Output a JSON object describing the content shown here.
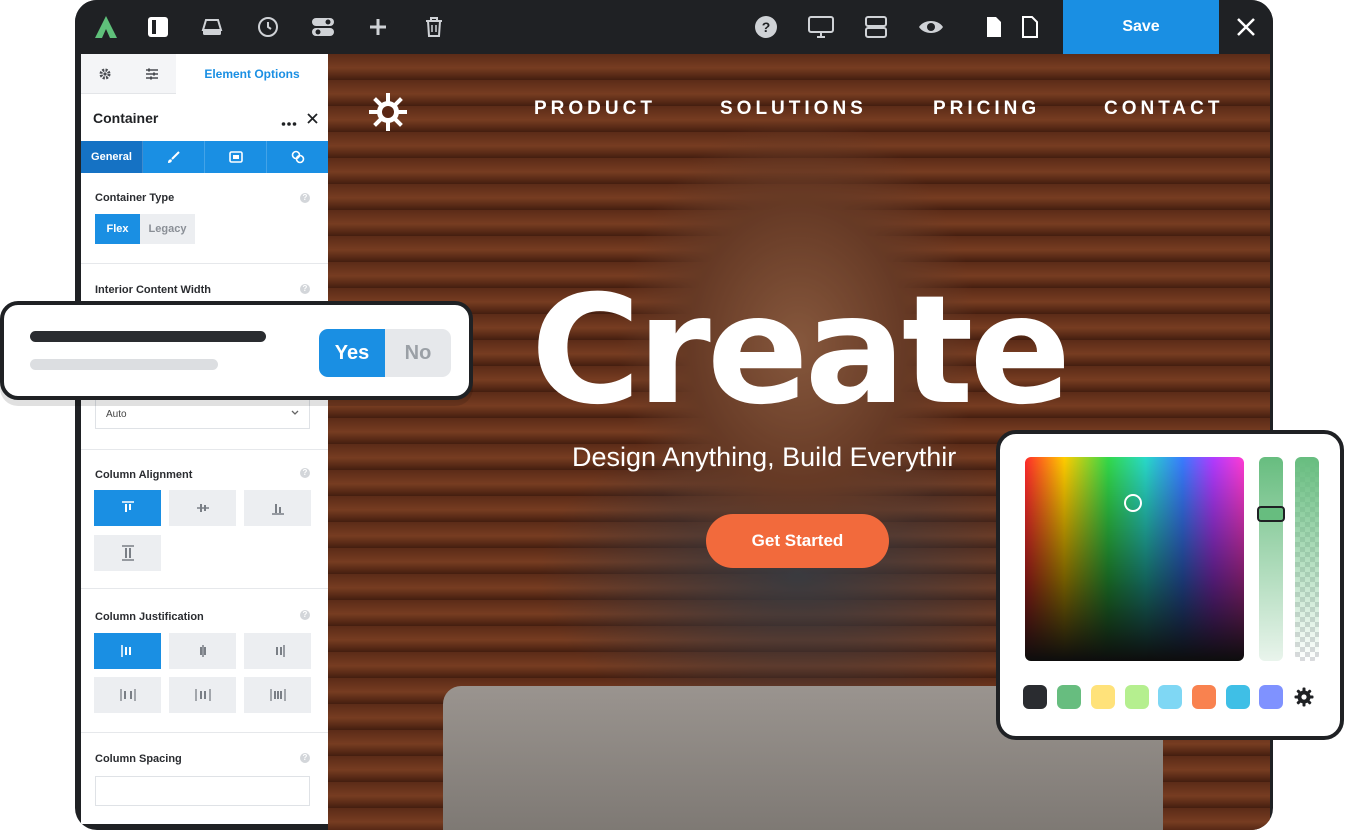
{
  "topbar": {
    "icons": [
      "logo-icon",
      "layout-panel-icon",
      "drive-icon",
      "history-icon",
      "toggles-icon",
      "add-icon",
      "trash-icon"
    ],
    "right_icons": [
      "help-icon",
      "desktop-icon",
      "layers-icon",
      "preview-icon",
      "page-icon",
      "page-outline-icon"
    ],
    "save_label": "Save",
    "close_icon": "close-icon",
    "accent": "#1a8fe3"
  },
  "panel": {
    "tabs": {
      "active_label": "Element Options"
    },
    "title": "Container",
    "subtabs": {
      "general_label": "General"
    },
    "container_type": {
      "label": "Container Type",
      "options": [
        "Flex",
        "Legacy"
      ],
      "selected": "Flex"
    },
    "interior_width": {
      "label": "Interior Content Width"
    },
    "select_value": "Auto",
    "column_alignment": {
      "label": "Column Alignment"
    },
    "column_justification": {
      "label": "Column Justification"
    },
    "column_spacing": {
      "label": "Column Spacing",
      "value": ""
    }
  },
  "hero": {
    "nav": [
      "PRODUCT",
      "SOLUTIONS",
      "PRICING",
      "CONTACT"
    ],
    "title": "Create",
    "subtitle": "Design Anything, Build Everythir",
    "cta_label": "Get Started",
    "cta_color": "#f26a3c"
  },
  "toggle_card": {
    "yes_label": "Yes",
    "no_label": "No"
  },
  "color_picker": {
    "swatches": [
      "#2a2c30",
      "#67bd7f",
      "#ffe27a",
      "#b5ef8f",
      "#7fd7f4",
      "#f9824f",
      "#3fbfe6",
      "#7f92ff"
    ],
    "selected_color": "#67bd7f"
  }
}
